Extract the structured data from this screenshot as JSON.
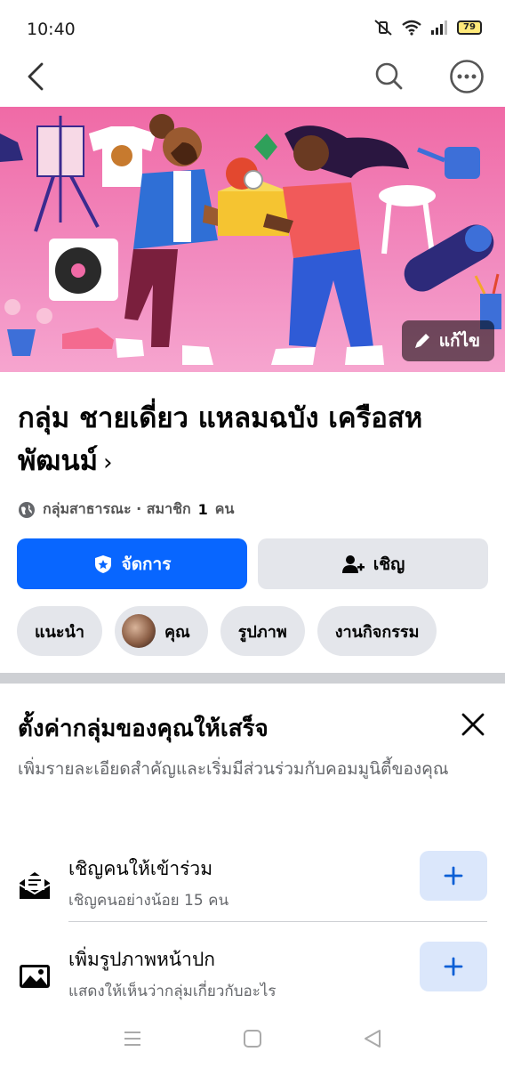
{
  "status": {
    "time": "10:40",
    "battery": "79"
  },
  "nav": {
    "back": "back",
    "search": "search",
    "more": "more"
  },
  "cover": {
    "edit_label": "แก้ไข"
  },
  "group": {
    "title": "กลุ่ม ชายเดี่ยว แหลมฉบัง เครือสหพัฒนม์",
    "chevron": "›",
    "privacy": "กลุ่มสาธารณะ · สมาชิก",
    "member_count": "1",
    "member_unit": "คน"
  },
  "actions": {
    "manage": "จัดการ",
    "invite": "เชิญ"
  },
  "tabs": [
    "แนะนำ",
    "คุณ",
    "รูปภาพ",
    "งานกิจกรรม"
  ],
  "setup": {
    "title": "ตั้งค่ากลุ่มของคุณให้เสร็จ",
    "description": "เพิ่มรายละเอียดสำคัญและเริ่มมีส่วนร่วมกับคอมมูนิตี้ของคุณ",
    "items": [
      {
        "title": "เชิญคนให้เข้าร่วม",
        "subtitle": "เชิญคนอย่างน้อย 15 คน",
        "icon": "invite-mail-icon"
      },
      {
        "title": "เพิ่มรูปภาพหน้าปก",
        "subtitle": "แสดงให้เห็นว่ากลุ่มเกี่ยวกับอะไร",
        "icon": "photo-icon"
      }
    ]
  },
  "colors": {
    "primary": "#0866ff",
    "secondary_bg": "#e4e6eb",
    "cover_pink": "#f28cc0",
    "add_bg": "#dbe7fb"
  }
}
